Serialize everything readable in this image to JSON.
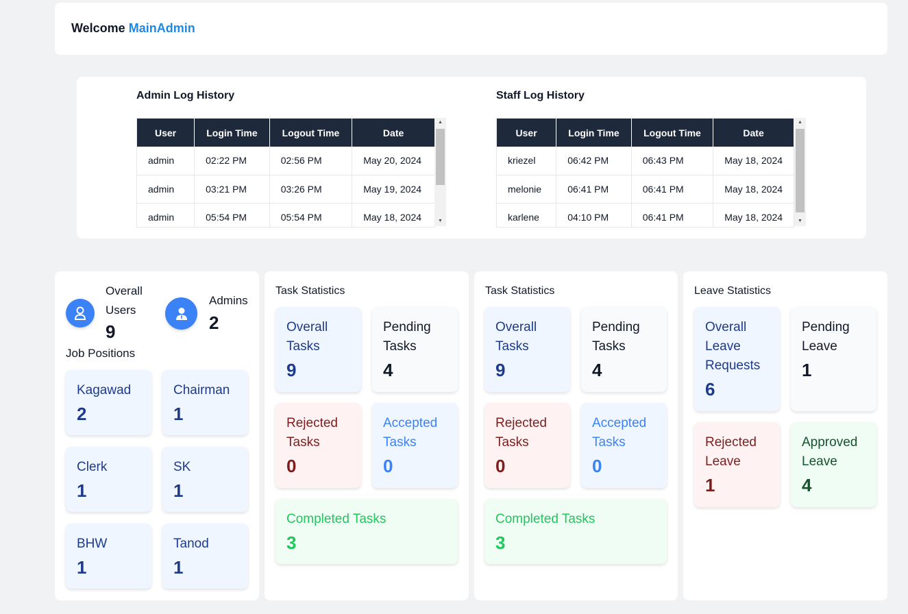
{
  "welcome": {
    "greeting": "Welcome",
    "username": "MainAdmin"
  },
  "admin_log": {
    "title": "Admin Log History",
    "columns": [
      "User",
      "Login Time",
      "Logout Time",
      "Date"
    ],
    "rows": [
      [
        "admin",
        "02:22 PM",
        "02:56 PM",
        "May 20, 2024"
      ],
      [
        "admin",
        "03:21 PM",
        "03:26 PM",
        "May 19, 2024"
      ],
      [
        "admin",
        "05:54 PM",
        "05:54 PM",
        "May 18, 2024"
      ]
    ]
  },
  "staff_log": {
    "title": "Staff Log History",
    "columns": [
      "User",
      "Login Time",
      "Logout Time",
      "Date"
    ],
    "rows": [
      [
        "kriezel",
        "06:42 PM",
        "06:43 PM",
        "May 18, 2024"
      ],
      [
        "melonie",
        "06:41 PM",
        "06:41 PM",
        "May 18, 2024"
      ],
      [
        "karlene",
        "04:10 PM",
        "06:41 PM",
        "May 18, 2024"
      ]
    ]
  },
  "users_panel": {
    "overall_users_label": "Overall Users",
    "overall_users_value": "9",
    "admins_label": "Admins",
    "admins_value": "2",
    "job_positions_label": "Job Positions",
    "positions": [
      {
        "label": "Kagawad",
        "value": "2"
      },
      {
        "label": "Chairman",
        "value": "1"
      },
      {
        "label": "Clerk",
        "value": "1"
      },
      {
        "label": "SK",
        "value": "1"
      },
      {
        "label": "BHW",
        "value": "1"
      },
      {
        "label": "Tanod",
        "value": "1"
      }
    ]
  },
  "task_stats_1": {
    "title": "Task Statistics",
    "overall": {
      "label": "Overall Tasks",
      "value": "9"
    },
    "pending": {
      "label": "Pending Tasks",
      "value": "4"
    },
    "rejected": {
      "label": "Rejected Tasks",
      "value": "0"
    },
    "accepted": {
      "label": "Accepted Tasks",
      "value": "0"
    },
    "completed": {
      "label": "Completed Tasks",
      "value": "3"
    }
  },
  "task_stats_2": {
    "title": "Task Statistics",
    "overall": {
      "label": "Overall Tasks",
      "value": "9"
    },
    "pending": {
      "label": "Pending Tasks",
      "value": "4"
    },
    "rejected": {
      "label": "Rejected Tasks",
      "value": "0"
    },
    "accepted": {
      "label": "Accepted Tasks",
      "value": "0"
    },
    "completed": {
      "label": "Completed Tasks",
      "value": "3"
    }
  },
  "leave_stats": {
    "title": "Leave Statistics",
    "overall": {
      "label": "Overall Leave Requests",
      "value": "6"
    },
    "pending": {
      "label": "Pending Leave",
      "value": "1"
    },
    "rejected": {
      "label": "Rejected Leave",
      "value": "1"
    },
    "approved": {
      "label": "Approved Leave",
      "value": "4"
    }
  },
  "icons": {
    "user": "user-icon",
    "admin": "admin-user-icon"
  },
  "colors": {
    "accent": "#3b82f6",
    "header_dark": "#1e293b",
    "name_blue": "#1e88e5"
  }
}
